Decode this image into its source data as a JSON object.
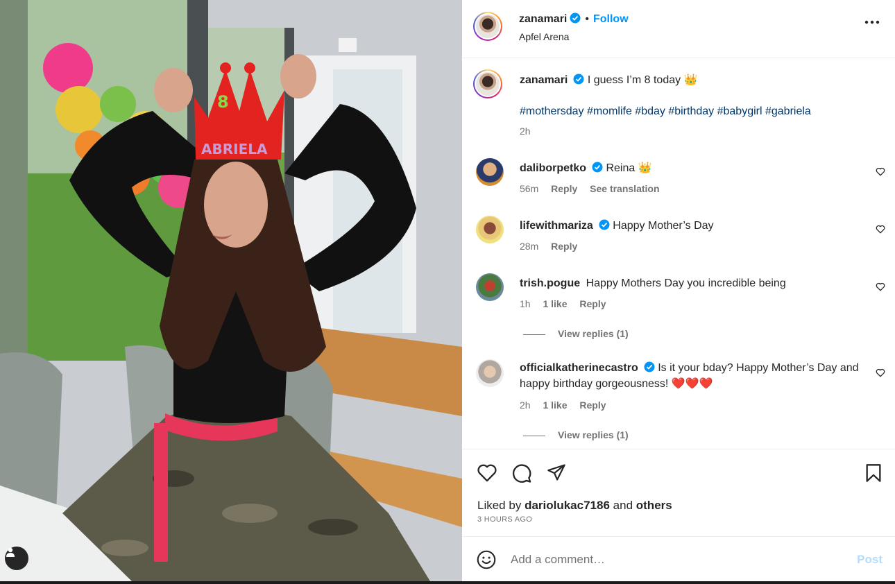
{
  "post": {
    "author": "zanamari",
    "follow_label": "Follow",
    "separator": "•",
    "location": "Apfel Arena",
    "more_icon": "more-horizontal-icon"
  },
  "caption": {
    "author": "zanamari",
    "text": "I guess I’m 8 today 👑",
    "hashtags": "#mothersday #momlife #bday #birthday #babygirl #gabriela",
    "time": "2h"
  },
  "comments": [
    {
      "user": "daliborpetko",
      "verified": true,
      "text": "Reina 👑",
      "time": "56m",
      "likes": "",
      "reply": "Reply",
      "translate": "See translation"
    },
    {
      "user": "lifewithmariza",
      "verified": true,
      "text": "Happy Mother’s Day",
      "time": "28m",
      "likes": "",
      "reply": "Reply",
      "translate": ""
    },
    {
      "user": "trish.pogue",
      "verified": false,
      "text": "Happy Mothers Day you incredible being",
      "time": "1h",
      "likes": "1 like",
      "reply": "Reply",
      "translate": "",
      "view_replies": "View replies (1)"
    },
    {
      "user": "officialkatherinecastro",
      "verified": true,
      "text": "Is it your bday? Happy Mother’s Day and happy birthday gorgeousness! ❤️❤️❤️",
      "time": "2h",
      "likes": "1 like",
      "reply": "Reply",
      "translate": "",
      "view_replies": "View replies (1)"
    }
  ],
  "actions": {
    "liked_prefix": "Liked by",
    "liked_user": "dariolukac7186",
    "liked_and": "and",
    "liked_others": "others",
    "timestamp": "3 HOURS AGO"
  },
  "add_comment": {
    "placeholder": "Add a comment…",
    "post_label": "Post"
  },
  "colors": {
    "accent": "#0095f6",
    "post_disabled": "#b3dbff",
    "hashtag": "#00376b",
    "secondary_text": "#737373"
  }
}
